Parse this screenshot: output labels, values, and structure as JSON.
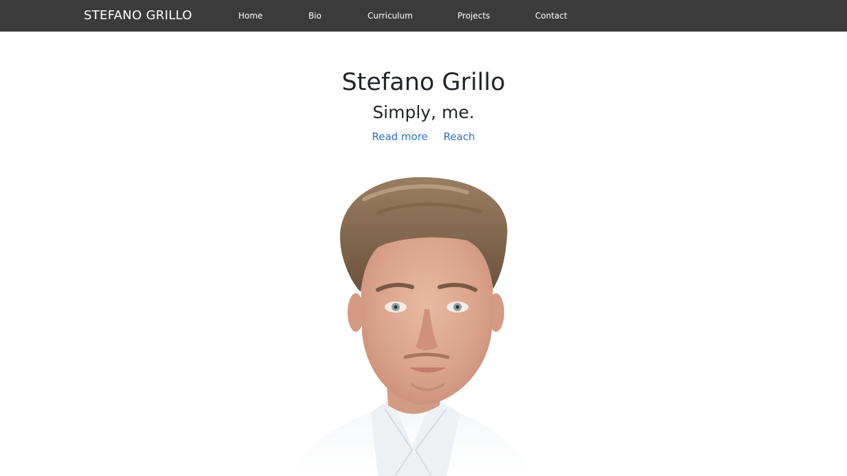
{
  "navbar": {
    "brand": "STEFANO GRILLO",
    "items": [
      {
        "label": "Home"
      },
      {
        "label": "Bio"
      },
      {
        "label": "Curriculum"
      },
      {
        "label": "Projects"
      },
      {
        "label": "Contact"
      }
    ]
  },
  "hero": {
    "title": "Stefano Grillo",
    "subtitle": "Simply, me.",
    "links": [
      {
        "label": "Read more"
      },
      {
        "label": "Reach"
      }
    ]
  },
  "portrait": {
    "icon": "portrait-photo"
  },
  "colors": {
    "navbar_bg": "#3b3b3b",
    "link": "#2f6ebf",
    "text": "#212529"
  }
}
